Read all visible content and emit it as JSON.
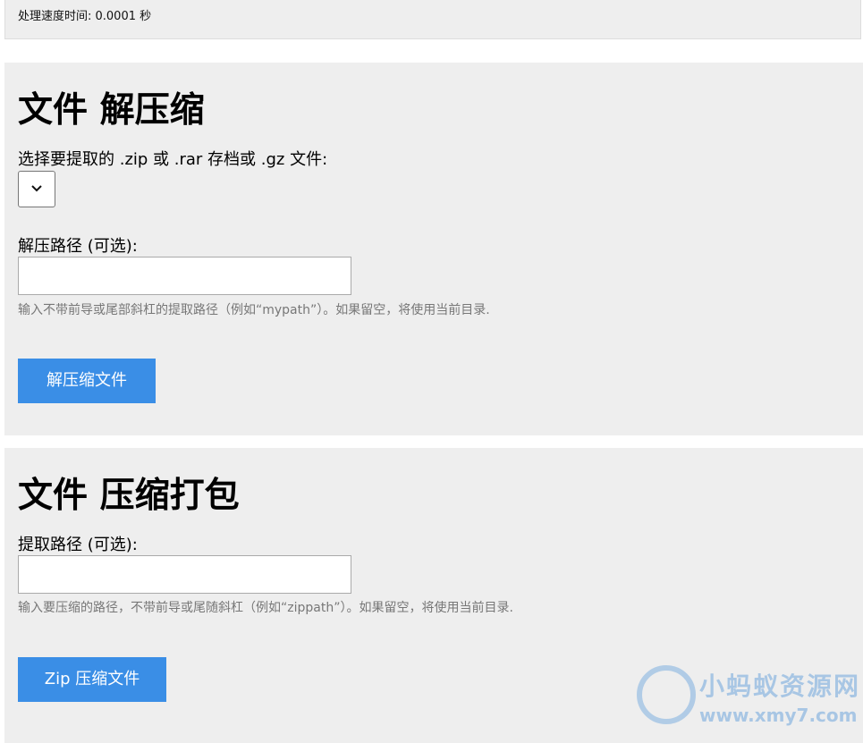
{
  "status": {
    "processing_time": "处理速度时间: 0.0001 秒"
  },
  "extract": {
    "title": "文件 解压缩",
    "archive_label": "选择要提取的 .zip 或 .rar 存档或 .gz 文件:",
    "archive_selected": "",
    "path_label": "解压路径 (可选):",
    "path_value": "",
    "path_help": "输入不带前导或尾部斜杠的提取路径（例如“mypath”）。如果留空，将使用当前目录.",
    "submit_label": "解压缩文件"
  },
  "compress": {
    "title": "文件 压缩打包",
    "path_label": "提取路径 (可选):",
    "path_value": "",
    "path_help": "输入要压缩的路径，不带前导或尾随斜杠（例如“zippath”）。如果留空，将使用当前目录.",
    "submit_label": "Zip 压缩文件"
  },
  "watermark": {
    "title": "小蚂蚁资源网",
    "url": "www.xmy7.com"
  },
  "icons": {
    "select_chevron": "chevron-down-icon",
    "watermark_logo": "ant-logo-icon"
  }
}
